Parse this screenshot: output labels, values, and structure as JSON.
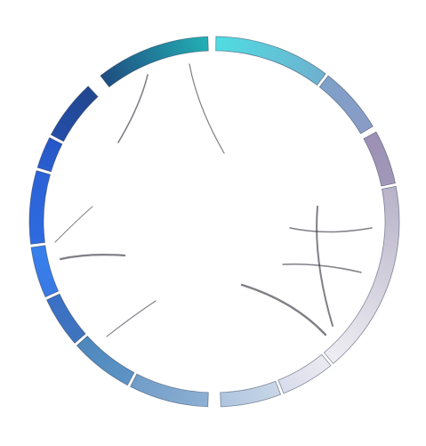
{
  "diagram": {
    "type": "chord",
    "labels": "none",
    "groups": [
      {
        "color": "#22b0b4"
      },
      {
        "color": "#1e8c9f"
      },
      {
        "color": "#1d4f86"
      },
      {
        "color": "#1f4fbf"
      },
      {
        "color": "#2a66df"
      },
      {
        "color": "#3a7fe9"
      },
      {
        "color": "#3a70c8"
      },
      {
        "color": "#3d78b6"
      },
      {
        "color": "#5a8fc0"
      },
      {
        "color": "#7ea4c9"
      },
      {
        "color": "#c1d0e2"
      },
      {
        "color": "#ccd4e4"
      },
      {
        "color": "#e6e5ee"
      },
      {
        "color": "#d6d2e0"
      },
      {
        "color": "#9a8fb0"
      },
      {
        "color": "#8c99c4"
      },
      {
        "color": "#5fcfd6"
      }
    ],
    "ribbons_note": ""
  }
}
